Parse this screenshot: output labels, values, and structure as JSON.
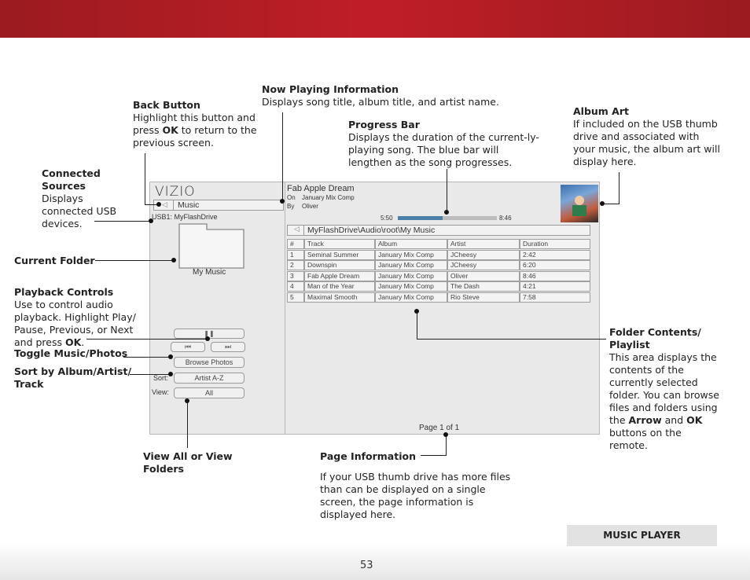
{
  "page": {
    "number": "53",
    "section_label": "MUSIC PLAYER"
  },
  "annotations": {
    "now_playing": {
      "title": "Now Playing Information",
      "body": "Displays song title, album title, and artist name."
    },
    "back_button": {
      "title": "Back Button",
      "body_1": "Highlight this button and press ",
      "key": "OK",
      "body_2": " to return to the previous screen."
    },
    "progress_bar": {
      "title": "Progress Bar",
      "body": "Displays the duration of the current-ly-playing song. The blue bar will lengthen as the song progresses."
    },
    "album_art": {
      "title": "Album Art",
      "body": "If included on the USB thumb drive and associated with your music, the album art will display here."
    },
    "connected_sources": {
      "title": "Connected Sources",
      "body": "Displays connected USB devices."
    },
    "current_folder": {
      "title": "Current Folder"
    },
    "playback_controls": {
      "title": "Playback Controls",
      "body_1": "Use to control audio playback. Highlight Play/ Pause, Previous, or Next and press ",
      "key": "OK",
      "body_2": "."
    },
    "toggle": {
      "title": "Toggle Music/Photos"
    },
    "sort": {
      "title": "Sort by Album/Artist/ Track"
    },
    "view_all": {
      "title": "View All or View Folders"
    },
    "page_info": {
      "title": "Page Information",
      "body": "If your USB thumb drive has more files than can be displayed on a single screen, the page information is displayed here."
    },
    "folder_contents": {
      "title": "Folder Contents/ Playlist",
      "body_1": "This area displays the contents of the currently selected folder. You can browse files and folders using the ",
      "key1": "Arrow",
      "mid": " and ",
      "key2": "OK",
      "body_2": " buttons on the remote."
    }
  },
  "tv": {
    "logo": "VIZIO",
    "tab_label": "Music",
    "source": "USB1: MyFlashDrive",
    "folder_name": "My Music",
    "now_playing": {
      "song": "Fab Apple Dream",
      "on_label": "On",
      "album": "January Mix Comp",
      "by_label": "By",
      "artist": "Oliver"
    },
    "progress": {
      "elapsed": "5:50",
      "total": "8:46",
      "fraction": 0.45
    },
    "path": "MyFlashDrive\\Audio\\root\\My Music",
    "table": {
      "headers": [
        "#",
        "Track",
        "Album",
        "Artist",
        "Duration"
      ],
      "rows": [
        [
          "1",
          "Seminal Summer",
          "January Mix Comp",
          "JCheesy",
          "2:42"
        ],
        [
          "2",
          "Downspin",
          "January Mix Comp",
          "JCheesy",
          "6:20"
        ],
        [
          "3",
          "Fab Apple Dream",
          "January Mix Comp",
          "Oliver",
          "8:46"
        ],
        [
          "4",
          "Man of the Year",
          "January Mix Comp",
          "The Dash",
          "4:21"
        ],
        [
          "5",
          "Maximal Smooth",
          "January Mix Comp",
          "Rio Steve",
          "7:58"
        ]
      ]
    },
    "browse_photos": "Browse Photos",
    "sort_label": "Sort:",
    "sort_value": "Artist A-Z",
    "view_label": "View:",
    "view_value": "All",
    "page_info": "Page 1 of 1"
  },
  "colors": {
    "brand_red": "#c01e26",
    "progress_blue": "#4a7fa8"
  }
}
